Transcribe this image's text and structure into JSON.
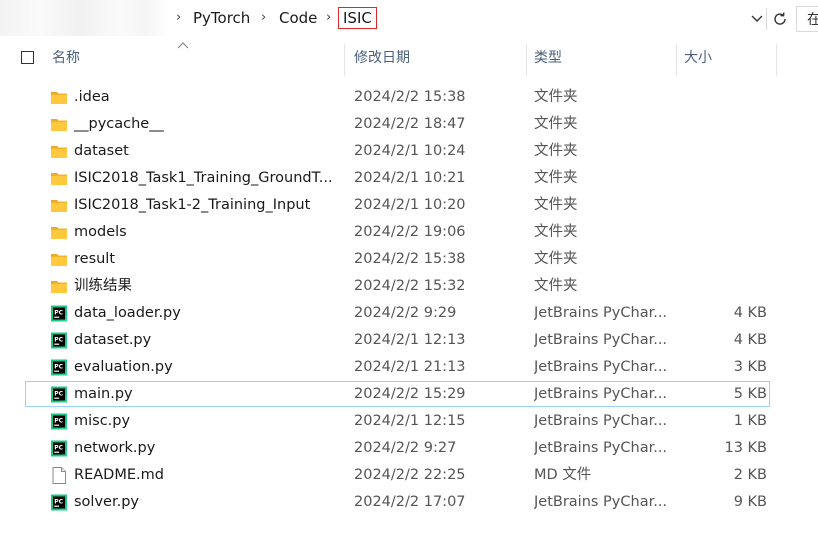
{
  "address_bar": {
    "breadcrumbs": [
      "PyTorch",
      "Code",
      "ISIC"
    ],
    "search_partial": "在"
  },
  "columns": {
    "name": "名称",
    "date_modified": "修改日期",
    "type": "类型",
    "size": "大小"
  },
  "colors": {
    "folder": "#ffc83d",
    "selection_border": "#99d1ff",
    "highlight_box": "#e0282a",
    "pycharm_bg": "#21d789"
  },
  "files": [
    {
      "name": ".idea",
      "date": "2024/2/2 15:38",
      "type": "文件夹",
      "size": "",
      "icon": "folder-icon"
    },
    {
      "name": "__pycache__",
      "date": "2024/2/2 18:47",
      "type": "文件夹",
      "size": "",
      "icon": "folder-icon"
    },
    {
      "name": "dataset",
      "date": "2024/2/1 10:24",
      "type": "文件夹",
      "size": "",
      "icon": "folder-icon"
    },
    {
      "name": "ISIC2018_Task1_Training_GroundT...",
      "date": "2024/2/1 10:21",
      "type": "文件夹",
      "size": "",
      "icon": "folder-icon"
    },
    {
      "name": "ISIC2018_Task1-2_Training_Input",
      "date": "2024/2/1 10:20",
      "type": "文件夹",
      "size": "",
      "icon": "folder-icon"
    },
    {
      "name": "models",
      "date": "2024/2/2 19:06",
      "type": "文件夹",
      "size": "",
      "icon": "folder-icon"
    },
    {
      "name": "result",
      "date": "2024/2/2 15:38",
      "type": "文件夹",
      "size": "",
      "icon": "folder-icon"
    },
    {
      "name": "训练结果",
      "date": "2024/2/2 15:32",
      "type": "文件夹",
      "size": "",
      "icon": "folder-icon"
    },
    {
      "name": "data_loader.py",
      "date": "2024/2/2 9:29",
      "type": "JetBrains PyChar...",
      "size": "4 KB",
      "icon": "pycharm-file-icon"
    },
    {
      "name": "dataset.py",
      "date": "2024/2/1 12:13",
      "type": "JetBrains PyChar...",
      "size": "4 KB",
      "icon": "pycharm-file-icon"
    },
    {
      "name": "evaluation.py",
      "date": "2024/2/1 21:13",
      "type": "JetBrains PyChar...",
      "size": "3 KB",
      "icon": "pycharm-file-icon"
    },
    {
      "name": "main.py",
      "date": "2024/2/2 15:29",
      "type": "JetBrains PyChar...",
      "size": "5 KB",
      "icon": "pycharm-file-icon",
      "selected": true
    },
    {
      "name": "misc.py",
      "date": "2024/2/1 12:15",
      "type": "JetBrains PyChar...",
      "size": "1 KB",
      "icon": "pycharm-file-icon"
    },
    {
      "name": "network.py",
      "date": "2024/2/2 9:27",
      "type": "JetBrains PyChar...",
      "size": "13 KB",
      "icon": "pycharm-file-icon"
    },
    {
      "name": "README.md",
      "date": "2024/2/2 22:25",
      "type": "MD 文件",
      "size": "2 KB",
      "icon": "document-file-icon"
    },
    {
      "name": "solver.py",
      "date": "2024/2/2 17:07",
      "type": "JetBrains PyChar...",
      "size": "9 KB",
      "icon": "pycharm-file-icon"
    }
  ]
}
